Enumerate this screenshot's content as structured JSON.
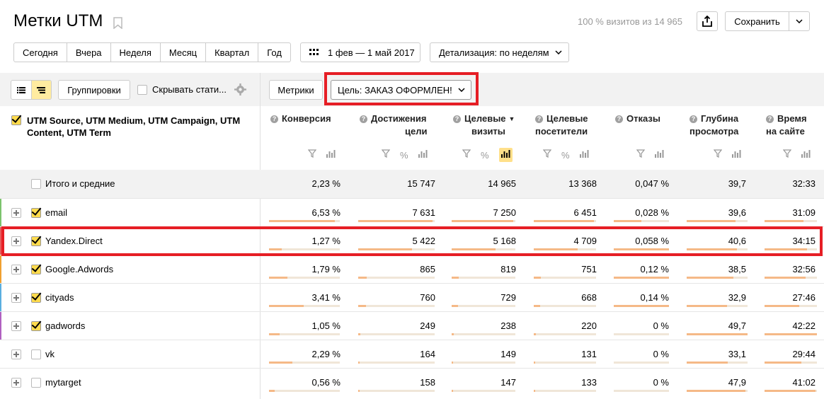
{
  "header": {
    "title": "Метки UTM",
    "visits_text": "100 % визитов из 14 965",
    "save_label": "Сохранить"
  },
  "period": {
    "segments": [
      "Сегодня",
      "Вчера",
      "Неделя",
      "Месяц",
      "Квартал",
      "Год"
    ],
    "date_range": "1 фев — 1 май 2017",
    "detail": "Детализация: по неделям"
  },
  "toolbar": {
    "groups_label": "Группировки",
    "hide_stats_label": "Скрывать стати...",
    "metrics_label": "Метрики",
    "goal_label": "Цель: ЗАКАЗ ОФОРМЛЕН!"
  },
  "table": {
    "dimension_header": "UTM Source, UTM Medium, UTM Campaign, UTM Content, UTM Term",
    "columns": [
      {
        "l1": "Конверсия",
        "l2": ""
      },
      {
        "l1": "Достижения",
        "l2": "цели"
      },
      {
        "l1": "Целевые",
        "l2": "визиты"
      },
      {
        "l1": "Целевые",
        "l2": "посетители"
      },
      {
        "l1": "Отказы",
        "l2": ""
      },
      {
        "l1": "Глубина",
        "l2": "просмотра"
      },
      {
        "l1": "Время",
        "l2": "на сайте"
      }
    ],
    "total": {
      "label": "Итого и средние",
      "values": [
        "2,23 %",
        "15 747",
        "14 965",
        "13 368",
        "0,047 %",
        "39,7",
        "32:33"
      ]
    },
    "rows": [
      {
        "label": "email",
        "checked": true,
        "mark": "#7cc36d",
        "values": [
          "6,53 %",
          "7 631",
          "7 250",
          "6 451",
          "0,028 %",
          "39,6",
          "31:09"
        ],
        "bars": [
          0.93,
          0.97,
          0.97,
          0.97,
          0.5,
          0.8,
          0.74
        ]
      },
      {
        "label": "Yandex.Direct",
        "checked": true,
        "mark": "#e65c5c",
        "values": [
          "1,27 %",
          "5 422",
          "5 168",
          "4 709",
          "0,058 %",
          "40,6",
          "34:15"
        ],
        "bars": [
          0.18,
          0.7,
          0.69,
          0.71,
          1.0,
          0.82,
          0.81
        ]
      },
      {
        "label": "Google.Adwords",
        "checked": true,
        "mark": "#f0a030",
        "values": [
          "1,79 %",
          "865",
          "819",
          "751",
          "0,12 %",
          "38,5",
          "32:56"
        ],
        "bars": [
          0.26,
          0.11,
          0.11,
          0.11,
          1.0,
          0.77,
          0.78
        ]
      },
      {
        "label": "cityads",
        "checked": true,
        "mark": "#5aaee0",
        "values": [
          "3,41 %",
          "760",
          "729",
          "668",
          "0,14 %",
          "32,9",
          "27:46"
        ],
        "bars": [
          0.49,
          0.1,
          0.1,
          0.1,
          1.0,
          0.66,
          0.66
        ]
      },
      {
        "label": "gadwords",
        "checked": true,
        "mark": "#b060c0",
        "values": [
          "1,05 %",
          "249",
          "238",
          "220",
          "0 %",
          "49,7",
          "42:22"
        ],
        "bars": [
          0.15,
          0.03,
          0.03,
          0.03,
          0,
          1.0,
          1.0
        ]
      },
      {
        "label": "vk",
        "checked": false,
        "mark": "",
        "values": [
          "2,29 %",
          "164",
          "149",
          "131",
          "0 %",
          "33,1",
          "29:44"
        ],
        "bars": [
          0.33,
          0.02,
          0.02,
          0.02,
          0,
          0.67,
          0.7
        ]
      },
      {
        "label": "mytarget",
        "checked": false,
        "mark": "",
        "values": [
          "0,56 %",
          "158",
          "147",
          "133",
          "0 %",
          "47,9",
          "41:02"
        ],
        "bars": [
          0.08,
          0.02,
          0.02,
          0.02,
          0,
          0.96,
          0.97
        ]
      }
    ]
  }
}
